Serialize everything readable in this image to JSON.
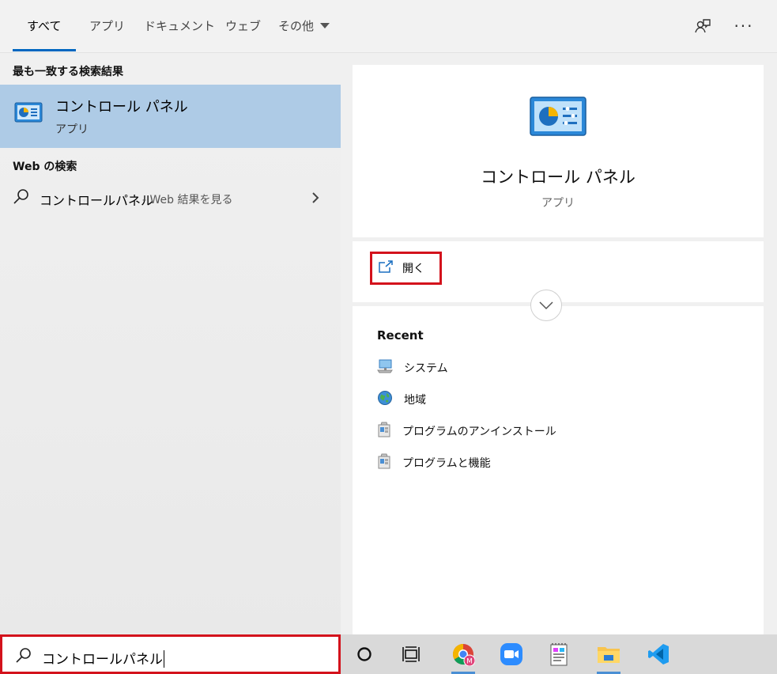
{
  "tabs": [
    {
      "label": "すべて"
    },
    {
      "label": "アプリ"
    },
    {
      "label": "ドキュメント"
    },
    {
      "label": "ウェブ"
    },
    {
      "label": "その他"
    }
  ],
  "left": {
    "best_match_title": "最も一致する検索結果",
    "best_match": {
      "name": "コントロール パネル",
      "type": "アプリ"
    },
    "web_title": "Web の検索",
    "web_result": {
      "query": "コントロールパネル",
      "suffix": "- Web 結果を見る"
    }
  },
  "right": {
    "app_name": "コントロール パネル",
    "app_type": "アプリ",
    "open_label": "開く",
    "recent_title": "Recent",
    "recent_items": [
      {
        "label": "システム",
        "icon": "system-icon"
      },
      {
        "label": "地域",
        "icon": "globe-icon"
      },
      {
        "label": "プログラムのアンインストール",
        "icon": "programs-icon"
      },
      {
        "label": "プログラムと機能",
        "icon": "programs-icon"
      }
    ]
  },
  "search": {
    "value": "コントロールパネル"
  },
  "colors": {
    "accent": "#0067c0",
    "selected_bg": "#aecbe6",
    "highlight_border": "#d3121c"
  }
}
